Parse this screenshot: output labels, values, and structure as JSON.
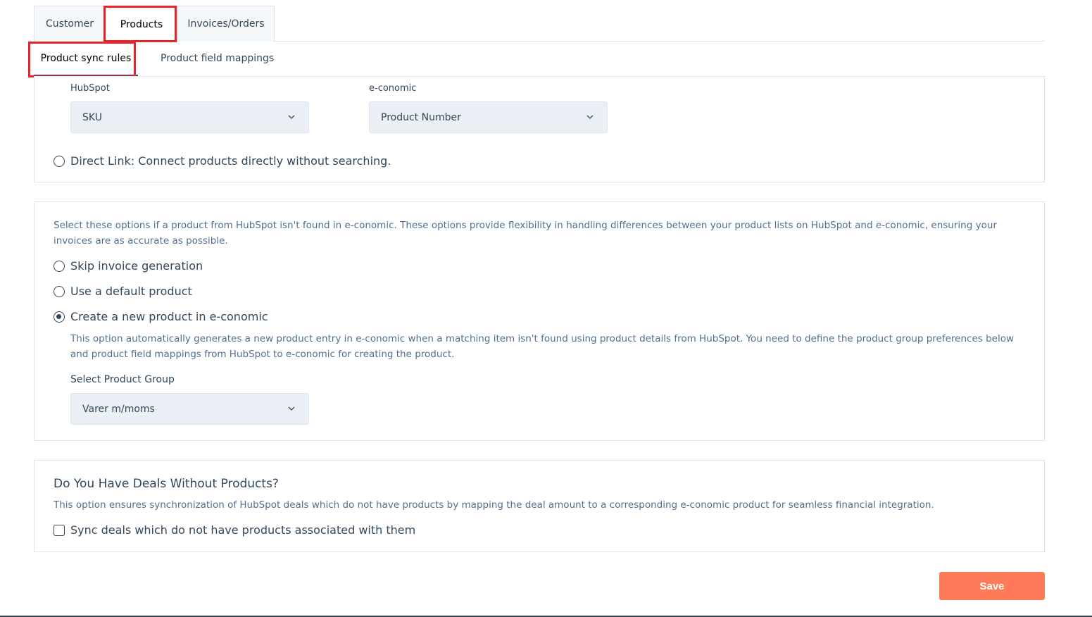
{
  "top_tabs": [
    "Customer",
    "Products",
    "Invoices/Orders"
  ],
  "sub_tabs": [
    "Product sync rules",
    "Product field mappings"
  ],
  "matching": {
    "hubspot_label": "HubSpot",
    "economic_label": "e-conomic",
    "hubspot_value": "SKU",
    "economic_value": "Product Number",
    "direct_link_label": "Direct Link: Connect products directly without searching."
  },
  "not_found": {
    "description": "Select these options if a product from HubSpot isn't found in e-conomic. These options provide flexibility in handling differences between your product lists on HubSpot and e-conomic, ensuring your invoices are as accurate as possible.",
    "options": [
      "Skip invoice generation",
      "Use a default product",
      "Create a new product in e-conomic"
    ],
    "selected_option": "Create a new product in e-conomic",
    "create_description": "This option automatically generates a new product entry in e-conomic when a matching item isn't found using product details from HubSpot. You need to define the product group preferences below and product field mappings from HubSpot to e-conomic for creating the product.",
    "product_group_label": "Select Product Group",
    "product_group_value": "Varer m/moms"
  },
  "deals": {
    "title": "Do You Have Deals Without Products?",
    "description": "This option ensures synchronization of HubSpot deals which do not have products by mapping the deal amount to a corresponding e-conomic product for seamless financial integration.",
    "checkbox_label": "Sync deals which do not have products associated with them",
    "checked": false
  },
  "save_label": "Save",
  "colors": {
    "accent": "#ff7a59",
    "highlight": "#e8242b",
    "text": "#33475b"
  }
}
